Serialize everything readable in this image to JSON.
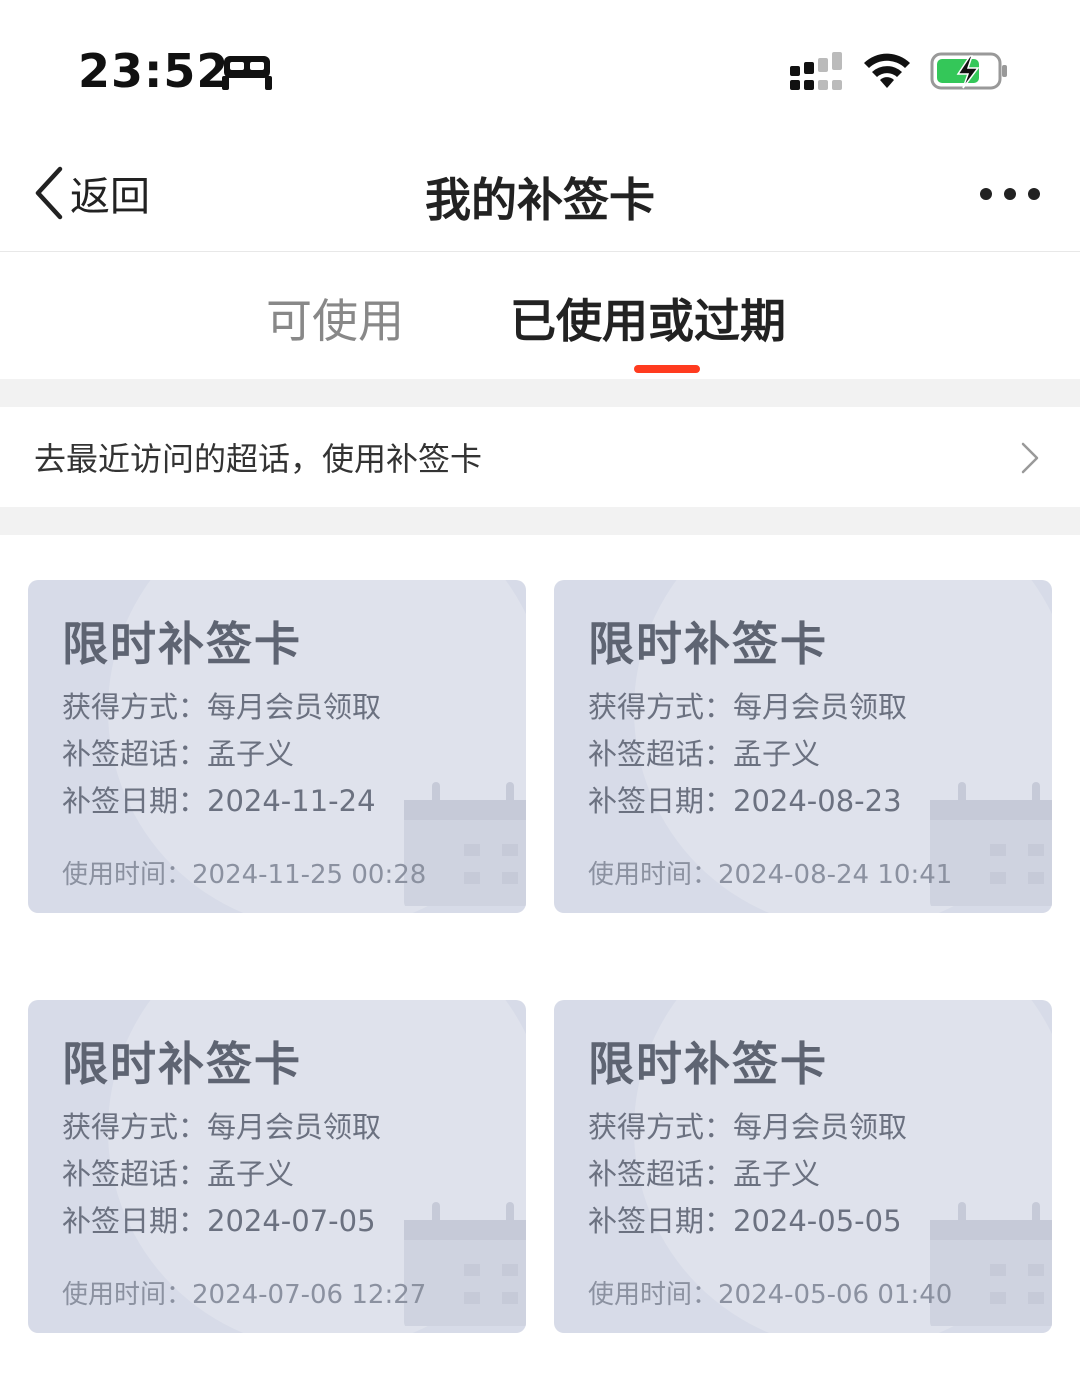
{
  "status_bar": {
    "time": "23:52",
    "icons": [
      "sleep-icon",
      "signal-icon",
      "wifi-icon",
      "battery-charging-icon"
    ]
  },
  "nav": {
    "back_label": "返回",
    "title": "我的补签卡",
    "more_icon": "more-icon"
  },
  "tabs": [
    {
      "label": "可使用",
      "active": false
    },
    {
      "label": "已使用或过期",
      "active": true
    }
  ],
  "colors": {
    "accent": "#ff3b1f",
    "card_bg": "#d7dbe8"
  },
  "banner": {
    "text": "去最近访问的超话，使用补签卡"
  },
  "cards": [
    {
      "title": "限时补签卡",
      "obtain": "获得方式：每月会员领取",
      "topic": "补签超话：孟子义",
      "date": "补签日期：2024-11-24",
      "used": "使用时间：2024-11-25 00:28"
    },
    {
      "title": "限时补签卡",
      "obtain": "获得方式：每月会员领取",
      "topic": "补签超话：孟子义",
      "date": "补签日期：2024-08-23",
      "used": "使用时间：2024-08-24 10:41"
    },
    {
      "title": "限时补签卡",
      "obtain": "获得方式：每月会员领取",
      "topic": "补签超话：孟子义",
      "date": "补签日期：2024-07-05",
      "used": "使用时间：2024-07-06 12:27"
    },
    {
      "title": "限时补签卡",
      "obtain": "获得方式：每月会员领取",
      "topic": "补签超话：孟子义",
      "date": "补签日期：2024-05-05",
      "used": "使用时间：2024-05-06 01:40"
    }
  ]
}
